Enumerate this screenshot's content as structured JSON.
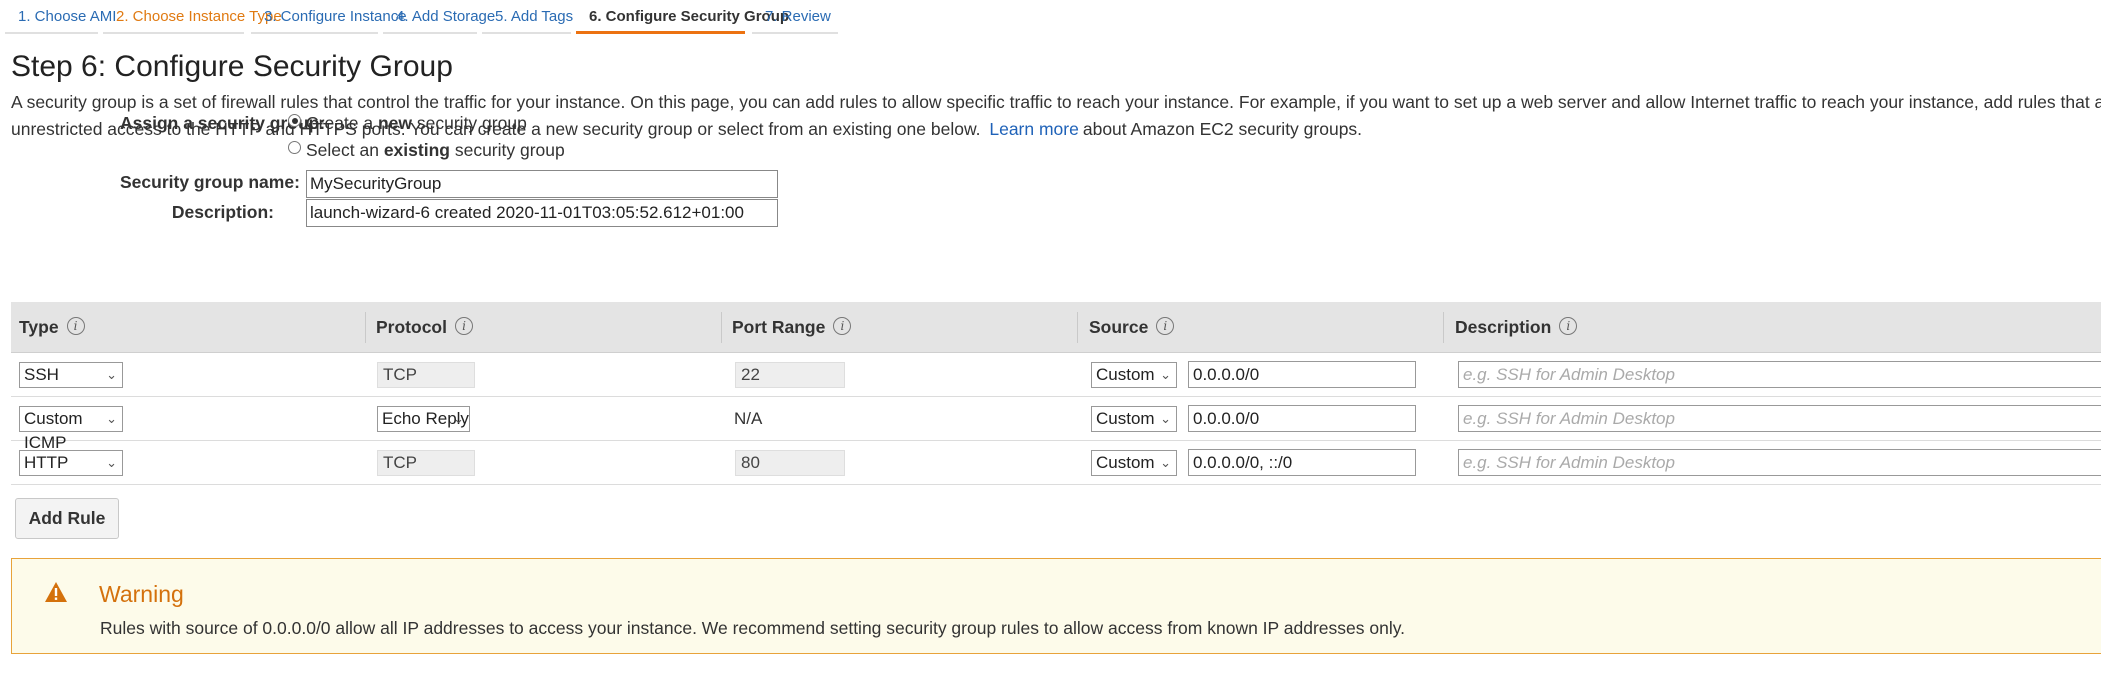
{
  "wizard": {
    "tabs": [
      {
        "label": "1. Choose AMI",
        "state": "done"
      },
      {
        "label": "2. Choose Instance Type",
        "state": "visited"
      },
      {
        "label": "3. Configure Instance",
        "state": "done"
      },
      {
        "label": "4. Add Storage",
        "state": "done"
      },
      {
        "label": "5. Add Tags",
        "state": "done"
      },
      {
        "label": "6. Configure Security Group",
        "state": "active"
      },
      {
        "label": "7. Review",
        "state": "done"
      }
    ]
  },
  "page": {
    "title": "Step 6: Configure Security Group",
    "intro_before_link": "A security group is a set of firewall rules that control the traffic for your instance. On this page, you can add rules to allow specific traffic to reach your instance. For example, if you want to set up a web server and allow Internet traffic to reach your instance, add rules that allow unrestricted access to the HTTP and HTTPS ports. You can create a new security group or select from an existing one below.",
    "learn_more": "Learn more",
    "intro_after_link": "about Amazon EC2 security groups."
  },
  "form": {
    "assign_label": "Assign a security group:",
    "option_create_pre": "Create a ",
    "option_create_bold": "new",
    "option_create_post": " security group",
    "option_select_pre": "Select an ",
    "option_select_bold": "existing",
    "option_select_post": " security group",
    "selected_option": "create",
    "name_label": "Security group name:",
    "name_value": "MySecurityGroup",
    "description_label": "Description:",
    "description_value": "launch-wizard-6 created 2020-11-01T03:05:52.612+01:00"
  },
  "rules_table": {
    "columns": [
      "Type",
      "Protocol",
      "Port Range",
      "Source",
      "Description"
    ],
    "info_glyph": "i",
    "rows": [
      {
        "type": "SSH",
        "protocol": "TCP",
        "protocol_select": false,
        "port": "22",
        "port_editable": true,
        "source_mode": "Custom",
        "source": "0.0.0.0/0",
        "description_placeholder": "e.g. SSH for Admin Desktop"
      },
      {
        "type": "Custom ICMP",
        "protocol": "Echo Reply",
        "protocol_select": true,
        "port": "N/A",
        "port_editable": false,
        "source_mode": "Custom",
        "source": "0.0.0.0/0",
        "description_placeholder": "e.g. SSH for Admin Desktop"
      },
      {
        "type": "HTTP",
        "protocol": "TCP",
        "protocol_select": false,
        "port": "80",
        "port_editable": true,
        "source_mode": "Custom",
        "source": "0.0.0.0/0, ::/0",
        "description_placeholder": "e.g. SSH for Admin Desktop"
      }
    ],
    "add_rule_label": "Add Rule"
  },
  "warning": {
    "title": "Warning",
    "text": "Rules with source of 0.0.0.0/0 allow all IP addresses to access your instance. We recommend setting security group rules to allow access from known IP addresses only."
  },
  "colors": {
    "accent_orange": "#ec7211",
    "link_blue": "#1f62b8",
    "warning_bg": "#fdfbea",
    "warning_border": "#e8a33a"
  },
  "icons": {
    "chevron": "chevron-down-icon",
    "info": "info-icon",
    "warning": "warning-triangle-icon"
  }
}
